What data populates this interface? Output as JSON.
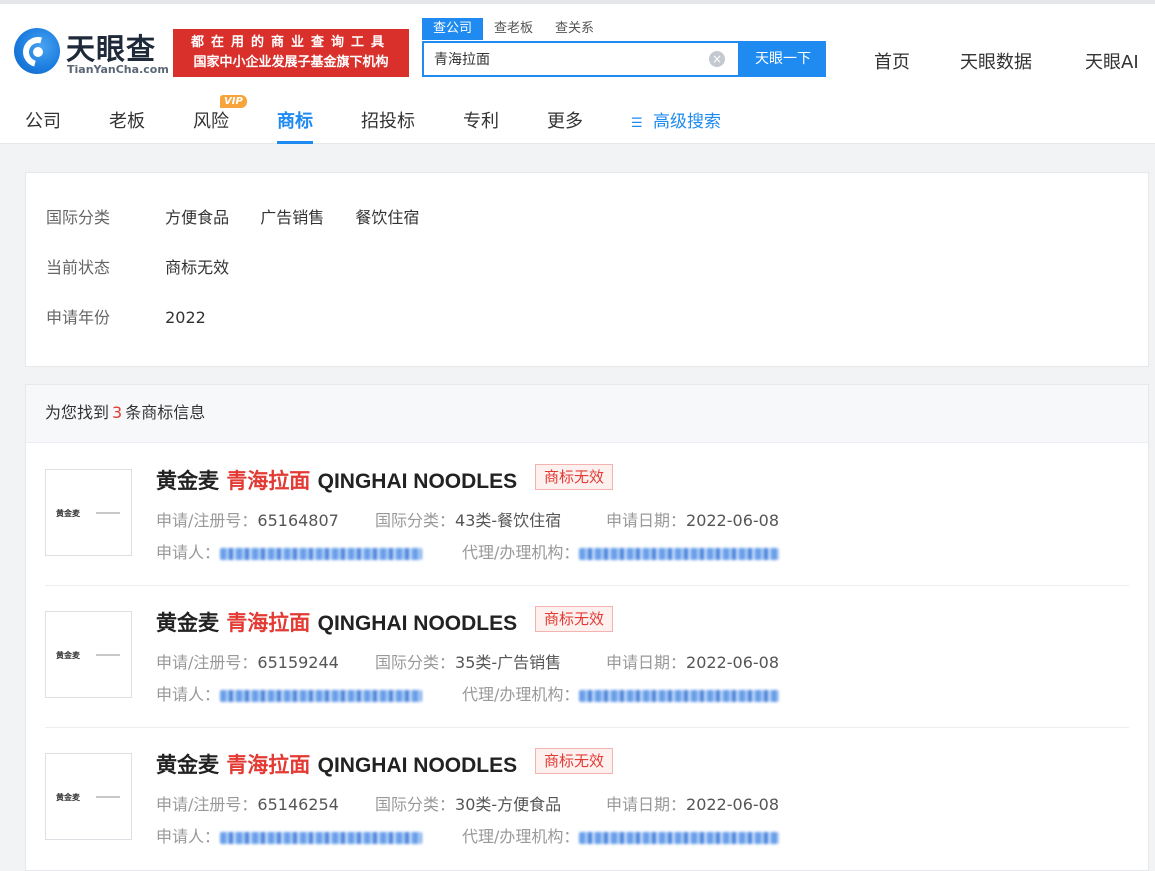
{
  "header": {
    "logo_cn": "天眼查",
    "logo_en": "TianYanCha.com",
    "slogan_line1": "都在用的商业查询工具",
    "slogan_line2": "国家中小企业发展子基金旗下机构",
    "search_tabs": [
      "查公司",
      "查老板",
      "查关系"
    ],
    "search_value": "青海拉面",
    "search_button": "天眼一下",
    "nav": [
      "首页",
      "天眼数据",
      "天眼AI"
    ]
  },
  "category_tabs": {
    "items": [
      "公司",
      "老板",
      "风险",
      "商标",
      "招投标",
      "专利",
      "更多"
    ],
    "vip_label": "VIP",
    "advanced_search": "高级搜索"
  },
  "filters": [
    {
      "label": "国际分类",
      "options": [
        "方便食品",
        "广告销售",
        "餐饮住宿"
      ]
    },
    {
      "label": "当前状态",
      "options": [
        "商标无效"
      ]
    },
    {
      "label": "申请年份",
      "options": [
        "2022"
      ]
    }
  ],
  "results": {
    "summary_prefix": "为您找到",
    "count": "3",
    "summary_suffix": "条商标信息",
    "labels": {
      "reg_no": "申请/注册号：",
      "intl_class": "国际分类：",
      "apply_date": "申请日期：",
      "applicant": "申请人：",
      "agency": "代理/办理机构："
    },
    "items": [
      {
        "name_prefix": "黄金麦",
        "name_highlight": "青海拉面",
        "name_suffix": "QINGHAI NOODLES",
        "status": "商标无效",
        "reg_no": "65164807",
        "intl_class": "43类-餐饮住宿",
        "apply_date": "2022-06-08",
        "thumb_text": "黄金麦"
      },
      {
        "name_prefix": "黄金麦",
        "name_highlight": "青海拉面",
        "name_suffix": "QINGHAI NOODLES",
        "status": "商标无效",
        "reg_no": "65159244",
        "intl_class": "35类-广告销售",
        "apply_date": "2022-06-08",
        "thumb_text": "黄金麦"
      },
      {
        "name_prefix": "黄金麦",
        "name_highlight": "青海拉面",
        "name_suffix": "QINGHAI NOODLES",
        "status": "商标无效",
        "reg_no": "65146254",
        "intl_class": "30类-方便食品",
        "apply_date": "2022-06-08",
        "thumb_text": "黄金麦"
      }
    ]
  },
  "colors": {
    "brand_blue": "#1f8bf0",
    "highlight_red": "#e33a33",
    "slogan_red": "#d9302c",
    "vip_orange": "#f7a43a"
  }
}
